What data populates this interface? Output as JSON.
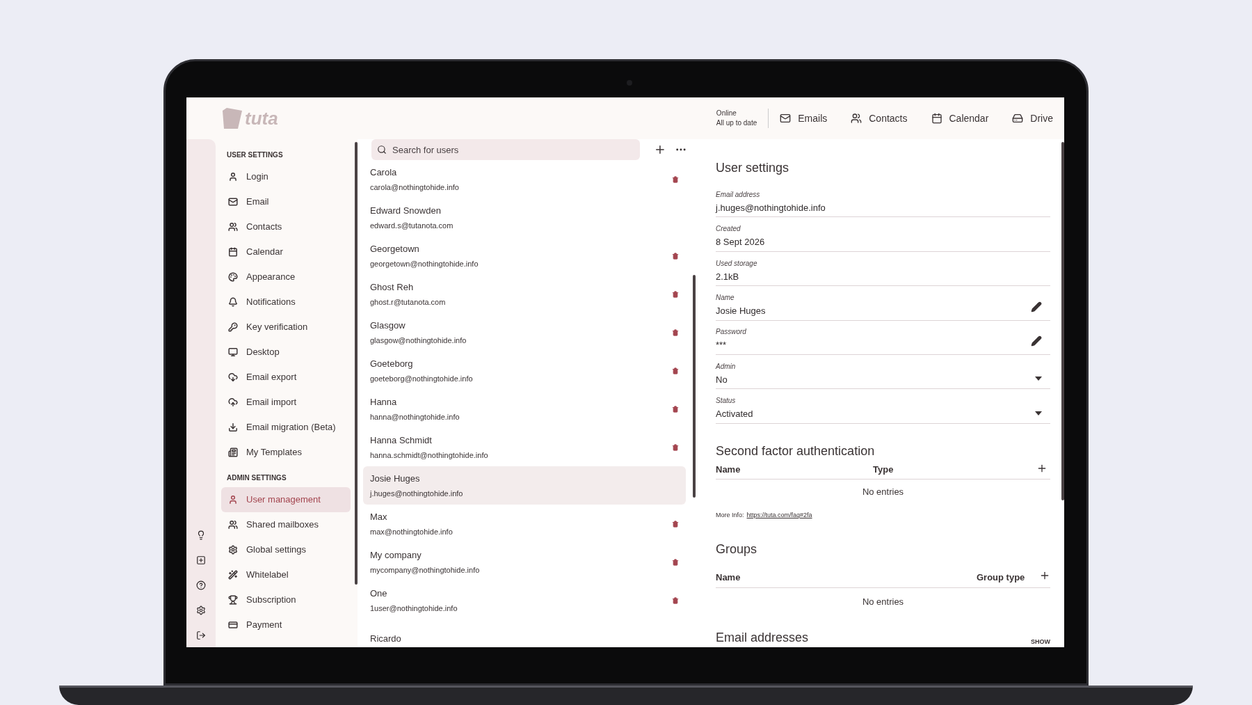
{
  "header": {
    "logo": "tuta",
    "status": [
      "Online",
      "All up to date"
    ],
    "nav": [
      {
        "label": "Emails"
      },
      {
        "label": "Contacts"
      },
      {
        "label": "Calendar"
      },
      {
        "label": "Drive"
      }
    ]
  },
  "sidebar": {
    "sections": [
      {
        "title": "USER SETTINGS",
        "items": [
          {
            "label": "Login",
            "selected": false
          },
          {
            "label": "Email",
            "selected": false
          },
          {
            "label": "Contacts",
            "selected": false
          },
          {
            "label": "Calendar",
            "selected": false
          },
          {
            "label": "Appearance",
            "selected": false
          },
          {
            "label": "Notifications",
            "selected": false
          },
          {
            "label": "Key verification",
            "selected": false
          },
          {
            "label": "Desktop",
            "selected": false
          },
          {
            "label": "Email export",
            "selected": false
          },
          {
            "label": "Email import",
            "selected": false
          },
          {
            "label": "Email migration (Beta)",
            "selected": false
          },
          {
            "label": "My Templates",
            "selected": false
          }
        ]
      },
      {
        "title": "ADMIN SETTINGS",
        "items": [
          {
            "label": "User management",
            "selected": true
          },
          {
            "label": "Shared mailboxes",
            "selected": false
          },
          {
            "label": "Global settings",
            "selected": false
          },
          {
            "label": "Whitelabel",
            "selected": false
          },
          {
            "label": "Subscription",
            "selected": false
          },
          {
            "label": "Payment",
            "selected": false
          }
        ]
      }
    ]
  },
  "user_list": {
    "search": {
      "placeholder": "Search for users"
    },
    "users": [
      {
        "name": "Carola",
        "email": "carola@nothingtohide.info",
        "deletable": true,
        "selected": false
      },
      {
        "name": "Edward Snowden",
        "email": "edward.s@tutanota.com",
        "deletable": false,
        "selected": false
      },
      {
        "name": "Georgetown",
        "email": "georgetown@nothingtohide.info",
        "deletable": true,
        "selected": false
      },
      {
        "name": "Ghost Reh",
        "email": "ghost.r@tutanota.com",
        "deletable": true,
        "selected": false
      },
      {
        "name": "Glasgow",
        "email": "glasgow@nothingtohide.info",
        "deletable": true,
        "selected": false
      },
      {
        "name": "Goeteborg",
        "email": "goeteborg@nothingtohide.info",
        "deletable": true,
        "selected": false
      },
      {
        "name": "Hanna",
        "email": "hanna@nothingtohide.info",
        "deletable": true,
        "selected": false
      },
      {
        "name": "Hanna Schmidt",
        "email": "hanna.schmidt@nothingtohide.info",
        "deletable": true,
        "selected": false
      },
      {
        "name": "Josie Huges",
        "email": "j.huges@nothingtohide.info",
        "deletable": false,
        "selected": true
      },
      {
        "name": "Max",
        "email": "max@nothingtohide.info",
        "deletable": true,
        "selected": false
      },
      {
        "name": "My company",
        "email": "mycompany@nothingtohide.info",
        "deletable": true,
        "selected": false
      },
      {
        "name": "One",
        "email": "1user@nothingtohide.info",
        "deletable": true,
        "selected": false
      },
      {
        "name": "Ricardo",
        "deletable": false,
        "selected": false
      }
    ]
  },
  "details": {
    "title": "User settings",
    "fields": [
      {
        "label": "Email address",
        "value": "j.huges@nothingtohide.info",
        "kind": "text"
      },
      {
        "label": "Created",
        "value": "8 Sept 2026",
        "kind": "text"
      },
      {
        "label": "Used storage",
        "value": "2.1kB",
        "kind": "text"
      },
      {
        "label": "Name",
        "value": "Josie Huges",
        "kind": "editable"
      },
      {
        "label": "Password",
        "value": "***",
        "kind": "editable"
      },
      {
        "label": "Admin",
        "value": "No",
        "kind": "dropdown"
      },
      {
        "label": "Status",
        "value": "Activated",
        "kind": "dropdown"
      }
    ],
    "second_factor": {
      "title": "Second factor authentication",
      "columns": [
        "Name",
        "Type"
      ],
      "empty": "No entries",
      "more_info": "More Info:",
      "link": "https://tuta.com/faq#2fa"
    },
    "groups": {
      "title": "Groups",
      "columns": [
        "Name",
        "Group type"
      ],
      "empty": "No entries"
    },
    "email_addresses": {
      "title": "Email addresses",
      "toggle": "SHOW"
    }
  }
}
